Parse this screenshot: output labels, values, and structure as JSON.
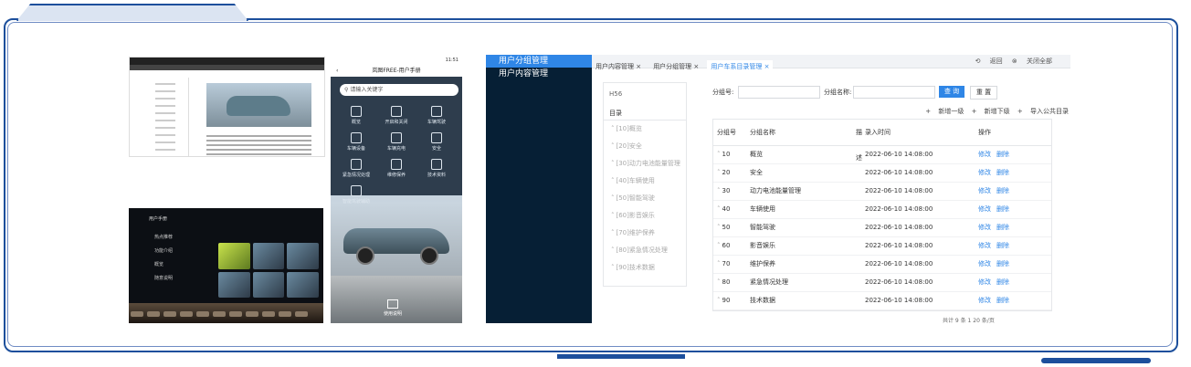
{
  "phone": {
    "status_time": "11:51",
    "title": "岚图FREE-用户手册",
    "search_placeholder": "请输入关键字",
    "grid": [
      "概览",
      "开启和关闭",
      "车辆驾驶",
      "车辆设备",
      "车辆充电",
      "安全",
      "紧急情况处理",
      "维修保养",
      "技术资料",
      "智能驾驶辅助"
    ],
    "footer": "使用说明"
  },
  "car_screen": {
    "title": "用户手册",
    "menu": [
      "热点推荐",
      "功能介绍",
      "概览",
      "随意说明"
    ]
  },
  "admin": {
    "sidebar": [
      {
        "label": "用户分组管理",
        "active": true
      },
      {
        "label": "用户内容管理",
        "active": false
      }
    ],
    "breadcrumbs": [
      {
        "label": "用户内容管理 ×",
        "active": false
      },
      {
        "label": "用户分组管理 ×",
        "active": false
      },
      {
        "label": "用户车系目录管理 ×",
        "active": true
      }
    ],
    "top_right": {
      "back": "返回",
      "close_all": "关闭全部"
    },
    "tree": {
      "code": "H56",
      "head": "目录",
      "items": [
        "[10]概览",
        "[20]安全",
        "[30]动力电池能量管理",
        "[40]车辆使用",
        "[50]智能驾驶",
        "[60]影音娱乐",
        "[70]维护保养",
        "[80]紧急情况处理",
        "[90]技术数据"
      ]
    },
    "filters": {
      "group_no_label": "分组号:",
      "group_name_label": "分组名称:",
      "query": "查 询",
      "reset": "重 置"
    },
    "actions": [
      "新增一级",
      "新增下级",
      "导入公共目录"
    ],
    "table": {
      "headers": [
        "分组号",
        "分组名称",
        "描述",
        "录入时间",
        "操作"
      ],
      "rows": [
        {
          "no": "10",
          "name": "概览",
          "time": "2022-06-10 14:08:00"
        },
        {
          "no": "20",
          "name": "安全",
          "time": "2022-06-10 14:08:00"
        },
        {
          "no": "30",
          "name": "动力电池能量管理",
          "time": "2022-06-10 14:08:00"
        },
        {
          "no": "40",
          "name": "车辆使用",
          "time": "2022-06-10 14:08:00"
        },
        {
          "no": "50",
          "name": "智能驾驶",
          "time": "2022-06-10 14:08:00"
        },
        {
          "no": "60",
          "name": "影音娱乐",
          "time": "2022-06-10 14:08:00"
        },
        {
          "no": "70",
          "name": "维护保养",
          "time": "2022-06-10 14:08:00"
        },
        {
          "no": "80",
          "name": "紧急情况处理",
          "time": "2022-06-10 14:08:00"
        },
        {
          "no": "90",
          "name": "技术数据",
          "time": "2022-06-10 14:08:00"
        }
      ],
      "edit": "修改",
      "delete": "删除"
    },
    "pager": "共计 9 条    1    20 条/页"
  }
}
